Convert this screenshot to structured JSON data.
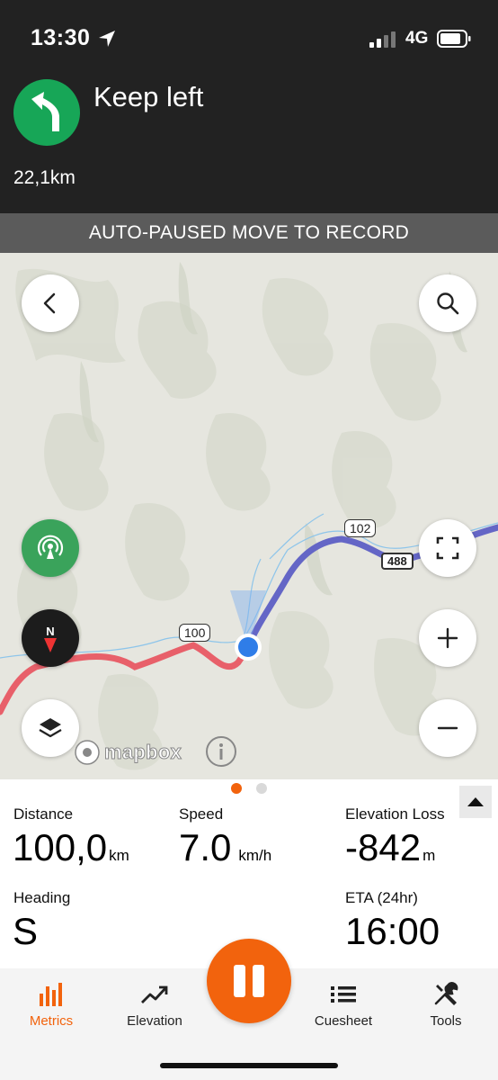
{
  "status_bar": {
    "time": "13:30",
    "network": "4G"
  },
  "navigation": {
    "instruction": "Keep left",
    "distance_to_turn": "22,1km",
    "turn_icon": "keep-left-arrow-icon",
    "turn_color": "#17a657"
  },
  "banner": {
    "text": "AUTO-PAUSED MOVE TO RECORD"
  },
  "map": {
    "route_markers": [
      "100",
      "102"
    ],
    "road_label": "488",
    "attribution": "mapbox",
    "compass_label": "N",
    "route_colors": {
      "completed": "#e8606a",
      "upcoming": "#6466c6"
    }
  },
  "metrics": {
    "page_index": 1,
    "page_count": 2,
    "distance": {
      "label": "Distance",
      "value": "100,0",
      "unit": "km"
    },
    "speed": {
      "label": "Speed",
      "value": "7.0",
      "unit": "km/h"
    },
    "elevation_loss": {
      "label": "Elevation Loss",
      "value": "-842",
      "unit": "m"
    },
    "heading": {
      "label": "Heading",
      "value": "S"
    },
    "eta": {
      "label": "ETA (24hr)",
      "value": "16:00"
    }
  },
  "tabs": [
    {
      "label": "Metrics",
      "icon": "bar-chart-icon",
      "active": true
    },
    {
      "label": "Elevation",
      "icon": "trend-up-icon",
      "active": false
    },
    {
      "label": "Cuesheet",
      "icon": "list-icon",
      "active": false
    },
    {
      "label": "Tools",
      "icon": "tools-icon",
      "active": false
    }
  ],
  "colors": {
    "accent": "#f2630d",
    "header_bg": "#222222",
    "banner_bg": "#5b5b5b"
  }
}
